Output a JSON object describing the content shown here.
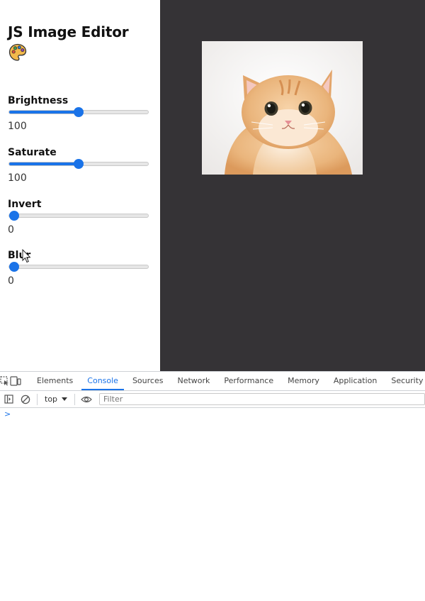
{
  "editor": {
    "title": "JS Image Editor",
    "title_emoji": "palette-icon",
    "controls": [
      {
        "label": "Brightness",
        "value": "100",
        "fraction": 0.5
      },
      {
        "label": "Saturate",
        "value": "100",
        "fraction": 0.5
      },
      {
        "label": "Invert",
        "value": "0",
        "fraction": 0.0
      },
      {
        "label": "Blur",
        "value": "0",
        "fraction": 0.0
      }
    ]
  },
  "preview": {
    "image_subject": "cat-photo",
    "background_color": "#353336"
  },
  "devtools": {
    "tabs": [
      "Elements",
      "Console",
      "Sources",
      "Network",
      "Performance",
      "Memory",
      "Application",
      "Security"
    ],
    "active_tab": "Console",
    "context": "top",
    "filter_placeholder": "Filter",
    "prompt": ">"
  },
  "colors": {
    "accent": "#1a73e8"
  }
}
